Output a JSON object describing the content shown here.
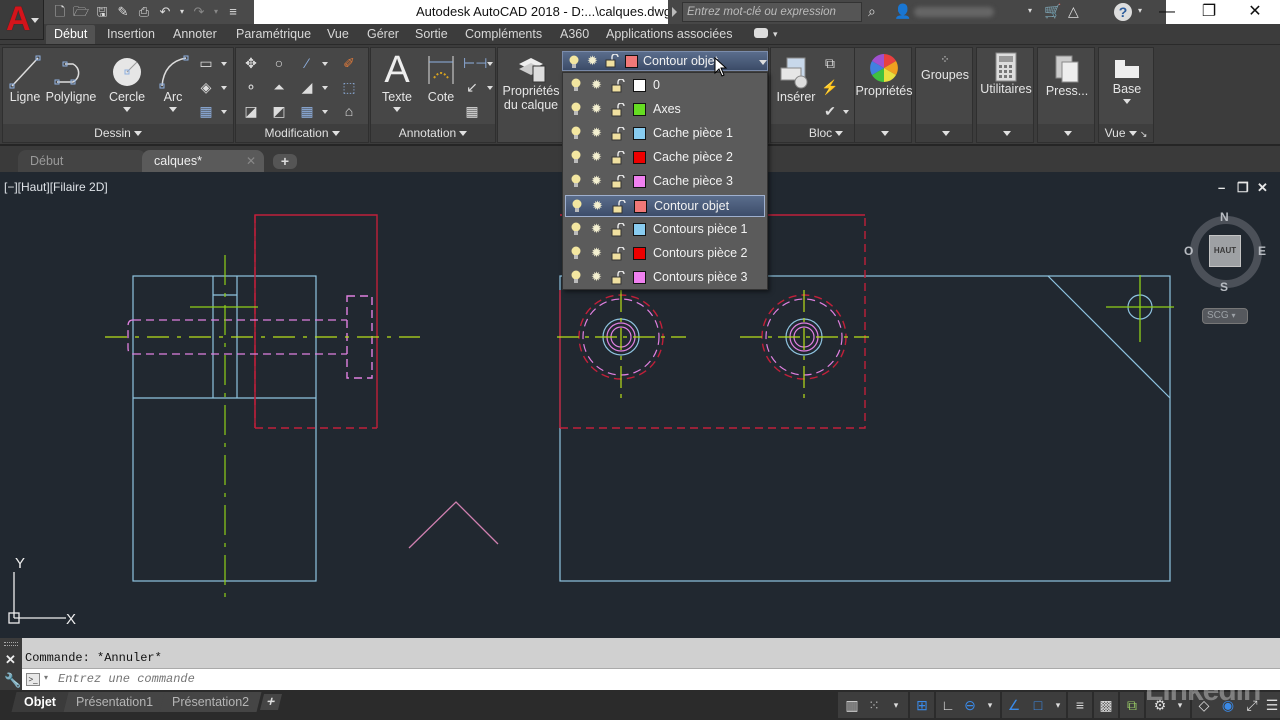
{
  "app": {
    "title": "Autodesk AutoCAD 2018 -   D:...\\calques.dwg",
    "logo_letter": "A",
    "search_placeholder": "Entrez mot-clé ou expression"
  },
  "quick_access": [
    "new-icon",
    "open-icon",
    "save-icon",
    "save-as-icon",
    "print-icon",
    "undo-icon",
    "redo-icon",
    "customize-icon"
  ],
  "window_controls": {
    "minimize": "—",
    "restore": "❐",
    "close": "✕"
  },
  "ribbon_tabs": [
    {
      "label": "Début",
      "active": true
    },
    {
      "label": "Insertion"
    },
    {
      "label": "Annoter"
    },
    {
      "label": "Paramétrique"
    },
    {
      "label": "Vue"
    },
    {
      "label": "Gérer"
    },
    {
      "label": "Sortie"
    },
    {
      "label": "Compléments"
    },
    {
      "label": "A360"
    },
    {
      "label": "Applications associées"
    }
  ],
  "ribbon": {
    "dessin": {
      "title": "Dessin",
      "ligne": "Ligne",
      "polyligne": "Polyligne",
      "cercle": "Cercle",
      "arc": "Arc"
    },
    "modification": {
      "title": "Modification"
    },
    "annotation": {
      "title": "Annotation",
      "texte": "Texte",
      "cote": "Cote"
    },
    "calques": {
      "proprietes_line1": "Propriétés",
      "proprietes_line2": "du calque"
    },
    "bloc": {
      "title": "Bloc",
      "inserer": "Insérer"
    },
    "proprietes": {
      "label": "Propriétés"
    },
    "groupes": {
      "label": "Groupes"
    },
    "utilitaires": {
      "label": "Utilitaires"
    },
    "presse_papiers": {
      "label": "Press..."
    },
    "vue": {
      "title": "Vue",
      "base": "Base"
    }
  },
  "layer_combo": {
    "current": "Contour objet",
    "current_color": "#f07878"
  },
  "layers": [
    {
      "name": "0",
      "color": "#ffffff"
    },
    {
      "name": "Axes",
      "color": "#66dd22"
    },
    {
      "name": "Cache pièce 1",
      "color": "#88ccf0"
    },
    {
      "name": "Cache pièce 2",
      "color": "#ee0000"
    },
    {
      "name": "Cache pièce 3",
      "color": "#f080f0"
    },
    {
      "name": "Contour objet",
      "color": "#f07878",
      "selected": true
    },
    {
      "name": "Contours pièce  1",
      "color": "#88ccf0"
    },
    {
      "name": "Contours pièce 2",
      "color": "#ee0000"
    },
    {
      "name": "Contours pièce 3",
      "color": "#f080f0"
    }
  ],
  "doc_tabs": [
    {
      "label": "Début",
      "active": false
    },
    {
      "label": "calques*",
      "active": true
    }
  ],
  "viewport": {
    "label": "[−][Haut][Filaire 2D]"
  },
  "viewcube": {
    "face": "HAUT",
    "north": "N",
    "south": "S",
    "east": "E",
    "west": "O",
    "ucs_menu": "SCG"
  },
  "ucs_icon": {
    "x": "X",
    "y": "Y"
  },
  "command": {
    "history": "Commande: *Annuler*",
    "placeholder": "Entrez une commande"
  },
  "layout_tabs": [
    {
      "label": "Objet",
      "active": true
    },
    {
      "label": "Présentation1"
    },
    {
      "label": "Présentation2"
    }
  ],
  "status_tools": [
    "grid-icon",
    "snap-icon",
    "dropdown",
    "dynamic-input-icon",
    "ortho-icon",
    "polar-icon",
    "dropdown",
    "isodraft-icon",
    "object-snap-icon",
    "dropdown",
    "lineweight-icon",
    "transparency-icon",
    "selection-cycling-icon",
    "annotation-scale-icon",
    "dropdown",
    "workspace-icon",
    "isolate-icon",
    "fullscreen-icon",
    "menu-icon"
  ],
  "watermark": "Linkedin",
  "colors": {
    "axes": "#b8e01a",
    "cache1": "#8fc4e0",
    "contour_red": "#c0203a",
    "magenta": "#e080e0"
  }
}
